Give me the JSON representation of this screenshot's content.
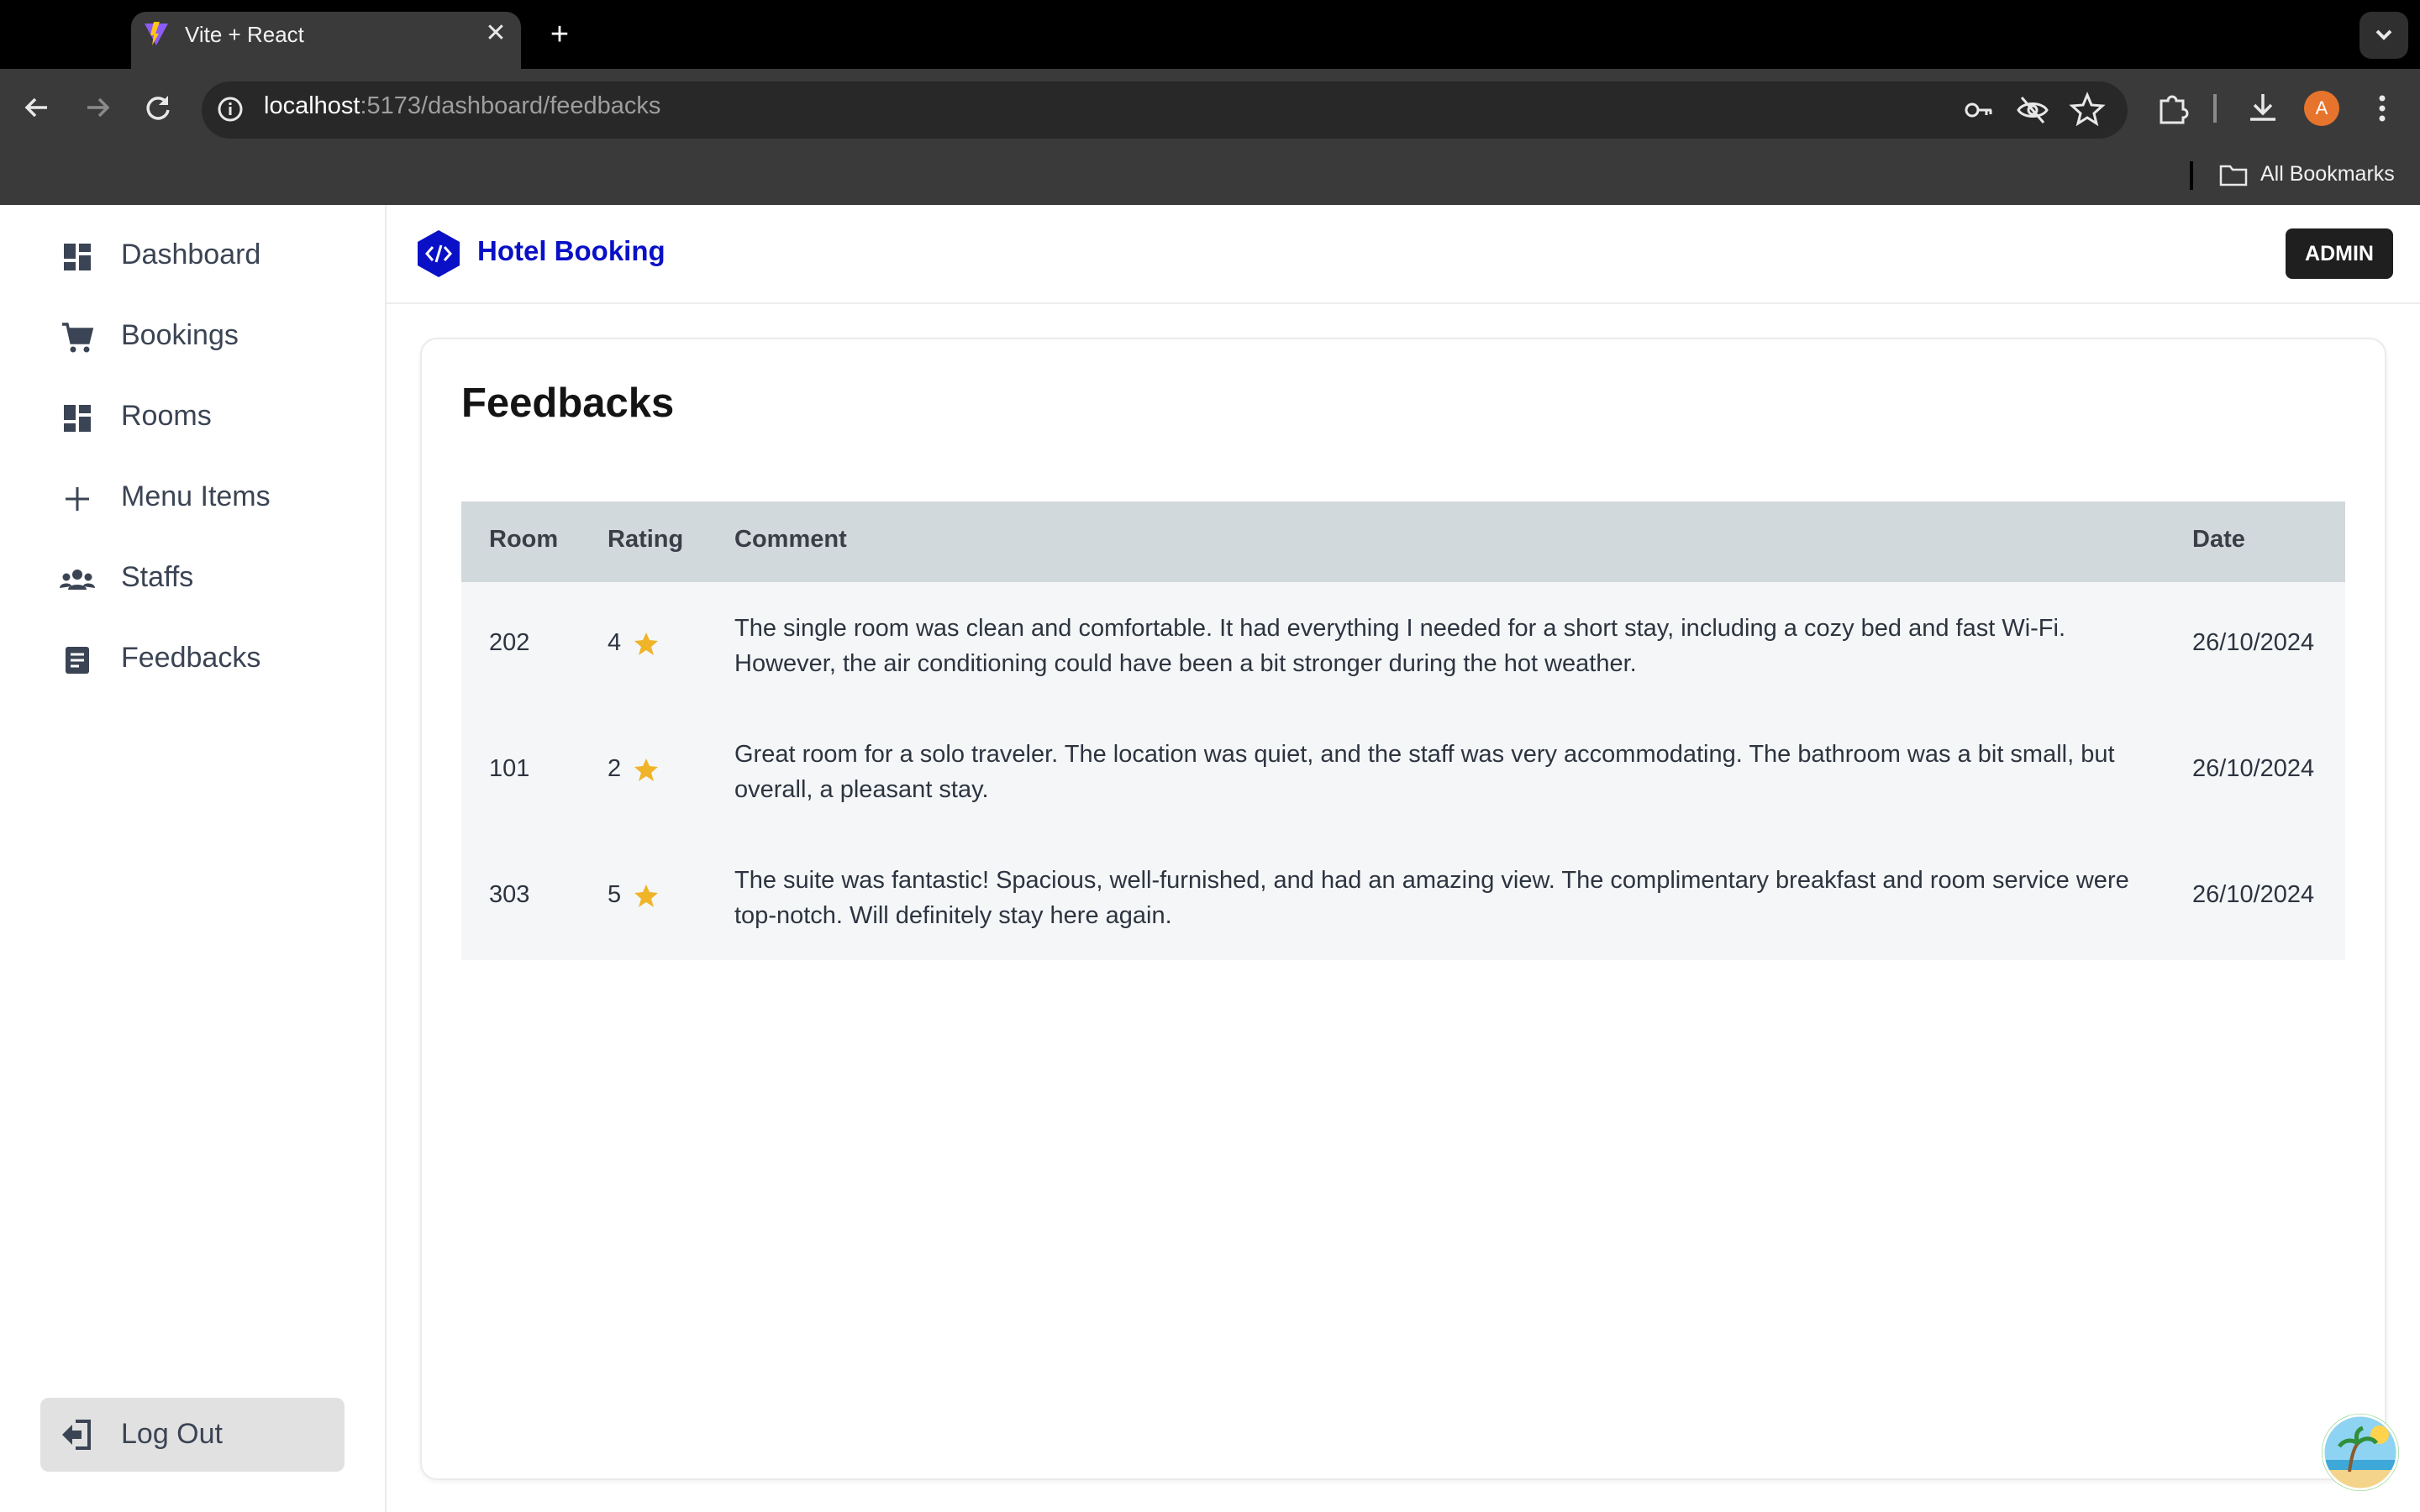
{
  "browser": {
    "tab_title": "Vite + React",
    "url_host": "localhost",
    "url_path": ":5173/dashboard/feedbacks",
    "bookmarks_label": "All Bookmarks",
    "profile_initial": "A"
  },
  "sidebar": {
    "items": [
      {
        "label": "Dashboard",
        "icon": "dashboard-icon"
      },
      {
        "label": "Bookings",
        "icon": "cart-icon"
      },
      {
        "label": "Rooms",
        "icon": "grid-icon"
      },
      {
        "label": "Menu Items",
        "icon": "plus-icon"
      },
      {
        "label": "Staffs",
        "icon": "people-icon"
      },
      {
        "label": "Feedbacks",
        "icon": "document-icon"
      }
    ],
    "logout_label": "Log Out"
  },
  "header": {
    "brand_name": "Hotel Booking",
    "brand_color": "#0a10c6",
    "admin_label": "ADMIN"
  },
  "main": {
    "title": "Feedbacks",
    "table": {
      "columns": [
        "Room",
        "Rating",
        "Comment",
        "Date"
      ],
      "rows": [
        {
          "room": "202",
          "rating": "4",
          "comment": "The single room was clean and comfortable. It had everything I needed for a short stay, including a cozy bed and fast Wi-Fi. However, the air conditioning could have been a bit stronger during the hot weather.",
          "date": "26/10/2024"
        },
        {
          "room": "101",
          "rating": "2",
          "comment": "Great room for a solo traveler. The location was quiet, and the staff was very accommodating. The bathroom was a bit small, but overall, a pleasant stay.",
          "date": "26/10/2024"
        },
        {
          "room": "303",
          "rating": "5",
          "comment": "The suite was fantastic! Spacious, well-furnished, and had an amazing view. The complimentary breakfast and room service were top-notch. Will definitely stay here again.",
          "date": "26/10/2024"
        }
      ]
    },
    "star_color": "#f0b429"
  }
}
